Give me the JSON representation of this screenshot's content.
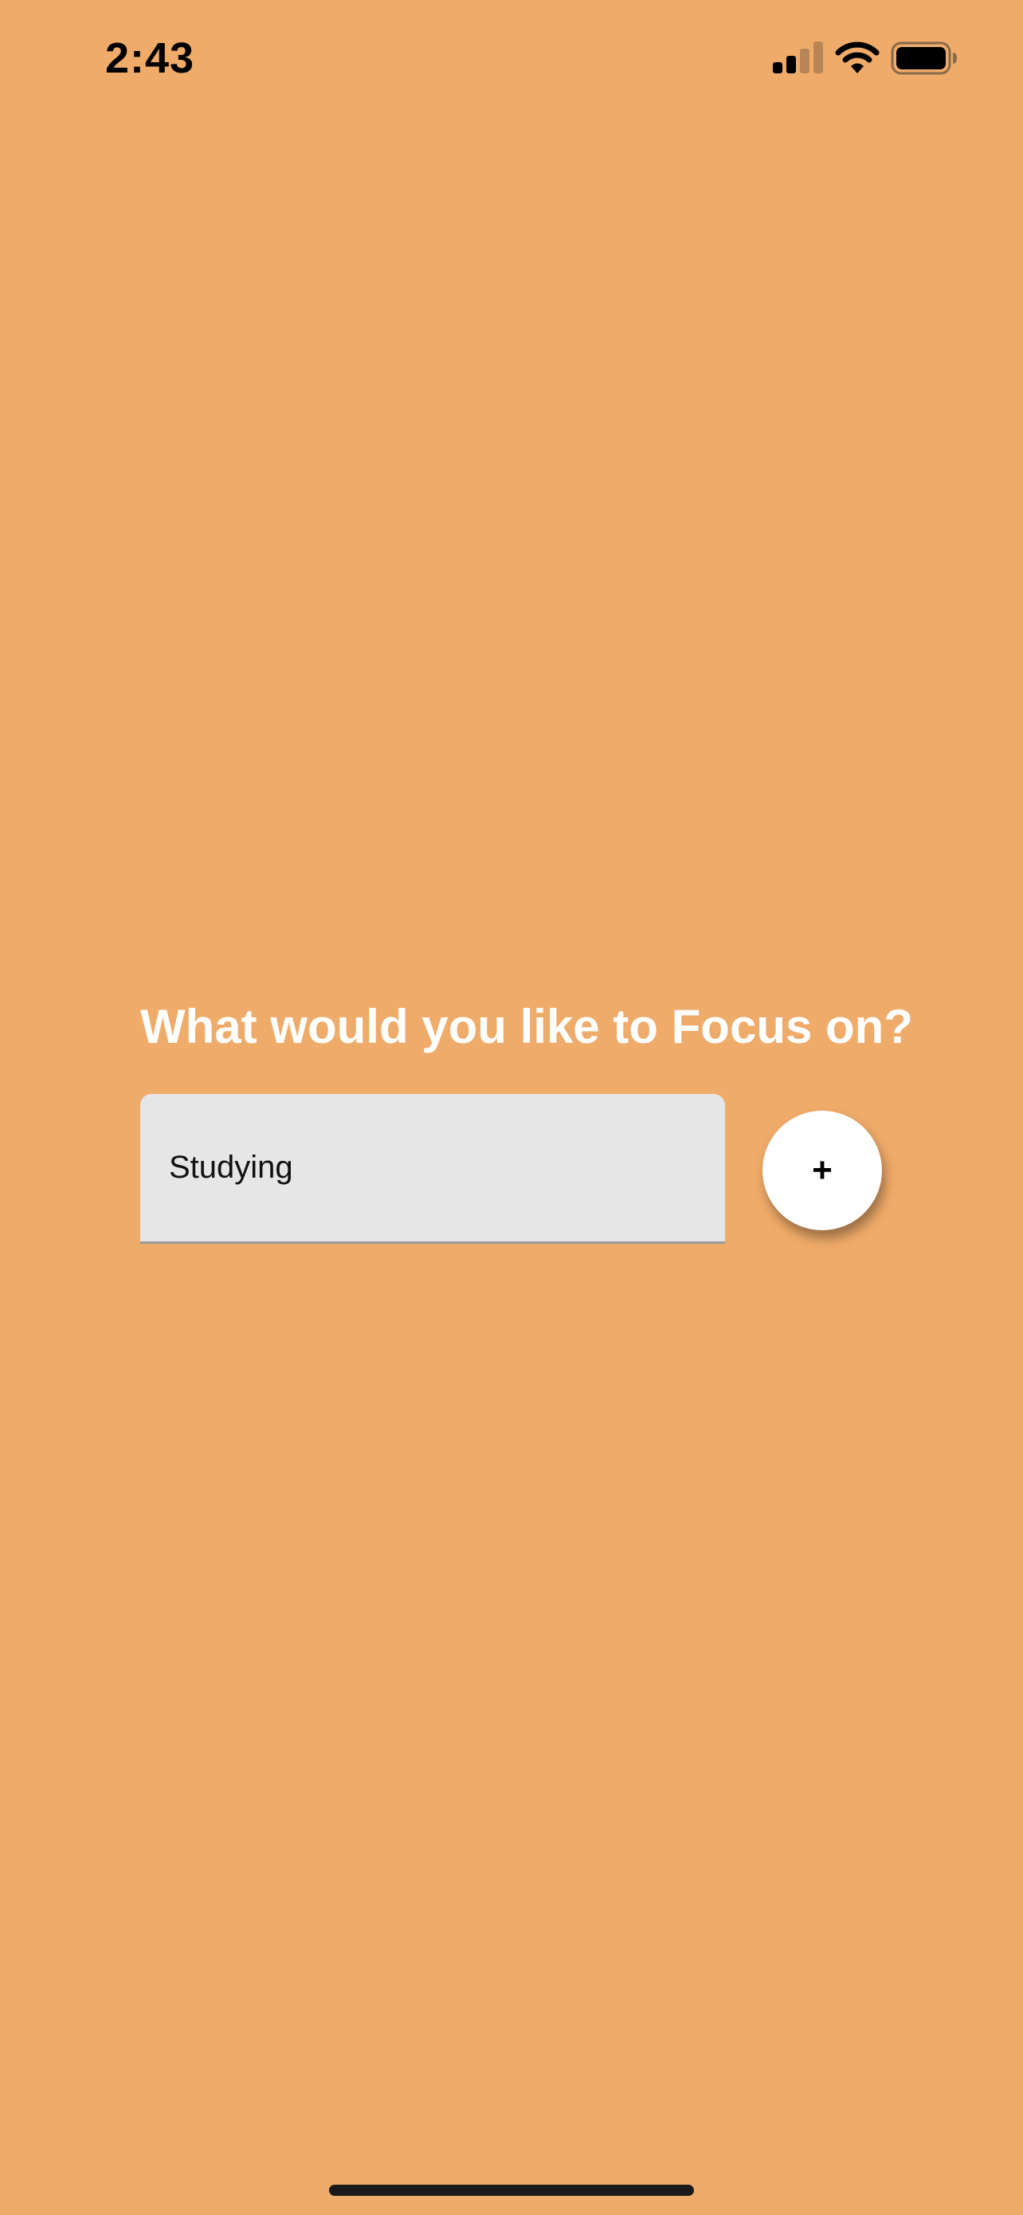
{
  "status_bar": {
    "time": "2:43",
    "signal_icon": "cellular-signal-icon",
    "wifi_icon": "wifi-icon",
    "battery_icon": "battery-icon"
  },
  "colors": {
    "background": "#EFAB69",
    "input_background": "#E6E6E6",
    "heading_text": "#FFFFFF"
  },
  "main": {
    "question": "What would you like to Focus on?",
    "focus_input": {
      "value": "Studying",
      "placeholder": ""
    },
    "add_button_label": "+"
  }
}
